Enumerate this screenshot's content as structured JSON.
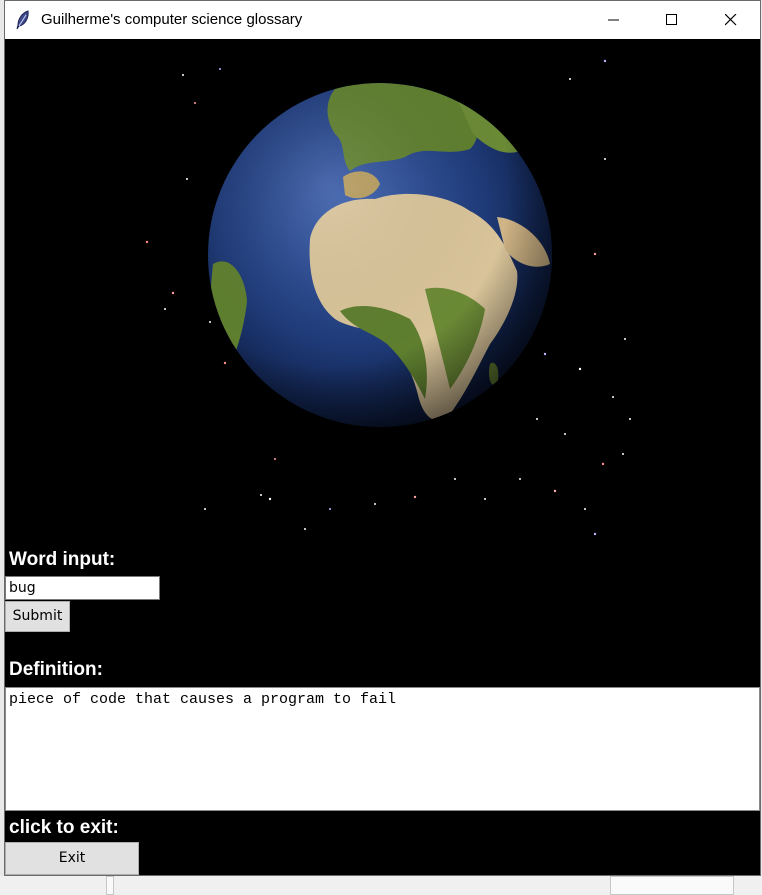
{
  "window": {
    "title": "Guilherme's computer science glossary"
  },
  "background_image": {
    "description_icon": "earth-globe-image"
  },
  "word_section": {
    "label": "Word input:",
    "input_value": "bug",
    "submit_label": "Submit"
  },
  "definition_section": {
    "label": "Definition:",
    "text": "piece of code that causes a program to fail"
  },
  "exit_section": {
    "label": "click to exit:",
    "exit_label": "Exit"
  },
  "colors": {
    "canvas": "#000000",
    "ocean": "#1e3a78",
    "land_green": "#5f7f2f",
    "desert": "#d9c49a"
  }
}
